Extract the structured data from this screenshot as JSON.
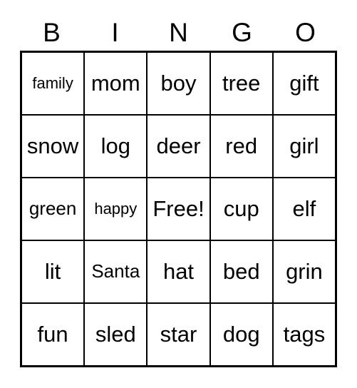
{
  "card": {
    "title": "BINGO",
    "columns": [
      {
        "letter": "B"
      },
      {
        "letter": "I"
      },
      {
        "letter": "N"
      },
      {
        "letter": "G"
      },
      {
        "letter": "O"
      }
    ],
    "free_space_label": "Free!",
    "free_space_position": {
      "row": 2,
      "col": 2
    },
    "colors": {
      "background": "#ffffff",
      "border": "#000000",
      "text": "#000000"
    },
    "rows": [
      [
        {
          "label": "family",
          "size": "sm"
        },
        {
          "label": "mom",
          "size": "lg"
        },
        {
          "label": "boy",
          "size": "lg"
        },
        {
          "label": "tree",
          "size": "lg"
        },
        {
          "label": "gift",
          "size": "lg"
        }
      ],
      [
        {
          "label": "snow",
          "size": "lg"
        },
        {
          "label": "log",
          "size": "lg"
        },
        {
          "label": "deer",
          "size": "lg"
        },
        {
          "label": "red",
          "size": "lg"
        },
        {
          "label": "girl",
          "size": "lg"
        }
      ],
      [
        {
          "label": "green",
          "size": "md"
        },
        {
          "label": "happy",
          "size": "sm"
        },
        {
          "label": "Free!",
          "size": "lg"
        },
        {
          "label": "cup",
          "size": "lg"
        },
        {
          "label": "elf",
          "size": "lg"
        }
      ],
      [
        {
          "label": "lit",
          "size": "lg"
        },
        {
          "label": "Santa",
          "size": "md"
        },
        {
          "label": "hat",
          "size": "lg"
        },
        {
          "label": "bed",
          "size": "lg"
        },
        {
          "label": "grin",
          "size": "lg"
        }
      ],
      [
        {
          "label": "fun",
          "size": "lg"
        },
        {
          "label": "sled",
          "size": "lg"
        },
        {
          "label": "star",
          "size": "lg"
        },
        {
          "label": "dog",
          "size": "lg"
        },
        {
          "label": "tags",
          "size": "lg"
        }
      ]
    ]
  }
}
